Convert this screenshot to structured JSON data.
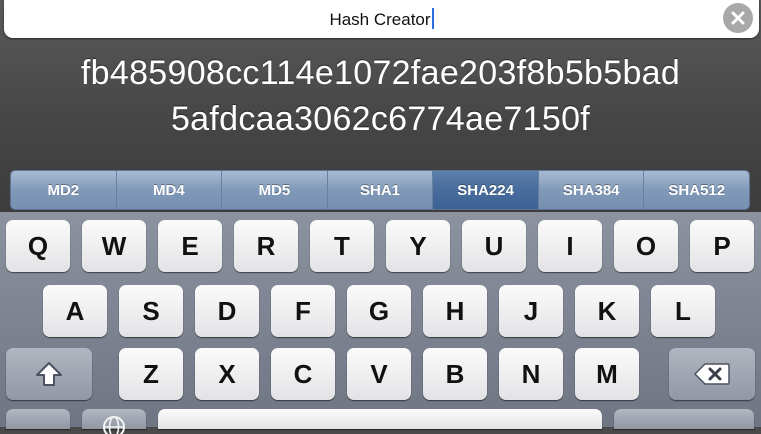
{
  "search": {
    "text": "Hash Creator",
    "clear_icon": "clear-icon"
  },
  "hash": {
    "line1": "fb485908cc114e1072fae203f8b5b5bad",
    "line2": "5afdcaa3062c6774ae7150f"
  },
  "algorithms": {
    "items": [
      "MD2",
      "MD4",
      "MD5",
      "SHA1",
      "SHA224",
      "SHA384",
      "SHA512"
    ],
    "selected": "SHA224"
  },
  "keyboard": {
    "row1": [
      "Q",
      "W",
      "E",
      "R",
      "T",
      "Y",
      "U",
      "I",
      "O",
      "P"
    ],
    "row2": [
      "A",
      "S",
      "D",
      "F",
      "G",
      "H",
      "J",
      "K",
      "L"
    ],
    "row3": [
      "Z",
      "X",
      "C",
      "V",
      "B",
      "N",
      "M"
    ],
    "shift_icon": "shift-icon",
    "delete_icon": "delete-icon",
    "globe_icon": "globe-icon"
  },
  "colors": {
    "segment": "#8199b8",
    "segment_selected": "#476c9c",
    "caret": "#2a6fe0"
  }
}
